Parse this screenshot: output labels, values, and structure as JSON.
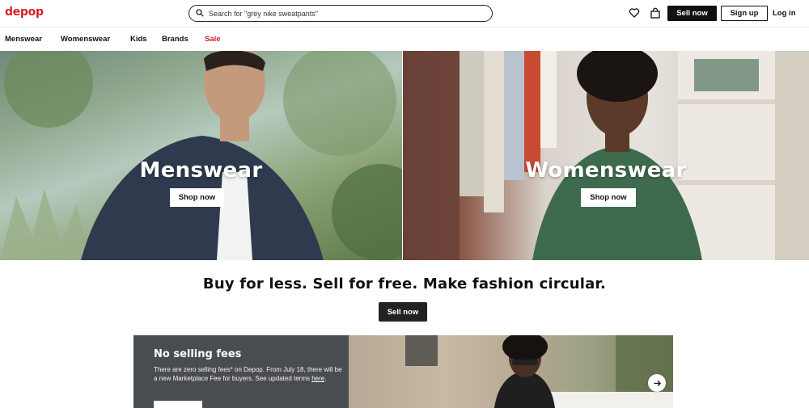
{
  "header": {
    "logo": "depop",
    "search_placeholder": "Search for \"grey nike sweatpants\"",
    "sell_label": "Sell now",
    "signup_label": "Sign up",
    "login_label": "Log in",
    "icons": [
      "heart-icon",
      "shopping-bag-icon",
      "search-icon"
    ]
  },
  "nav": {
    "items": [
      "Menswear",
      "Womenswear",
      "Kids",
      "Brands",
      "Sale"
    ],
    "sale_color": "#d61f26"
  },
  "hero": {
    "left": {
      "title": "Menswear",
      "button": "Shop now"
    },
    "right": {
      "title": "Womenswear",
      "button": "Shop now"
    }
  },
  "tagline": {
    "text": "Buy for less. Sell for free. Make fashion circular.",
    "button": "Sell now"
  },
  "promo": {
    "title": "No selling fees",
    "text_before_link": "There are zero selling fees* on Depop. From July 18, there will be a new Marketplace Fee for buyers. See updated terms ",
    "link": "here",
    "text_after_link": "."
  },
  "colors": {
    "brand_red": "#d61f26",
    "dark_button": "#111111",
    "promo_panel": "#4a4d4f"
  }
}
